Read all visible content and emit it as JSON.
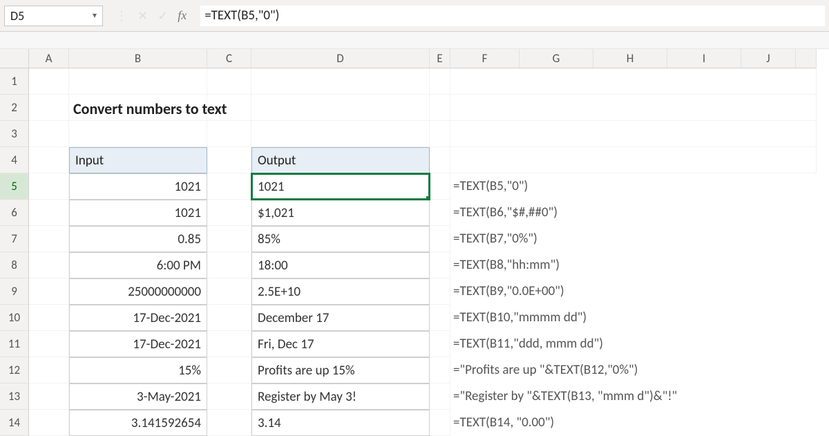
{
  "namebox": "D5",
  "formula_bar": "=TEXT(B5,\"0\")",
  "col_labels": [
    "A",
    "B",
    "C",
    "D",
    "E",
    "F",
    "G",
    "H",
    "I",
    "J"
  ],
  "col_widths_rest": [
    30,
    100,
    107,
    107,
    107,
    79
  ],
  "row_labels": [
    "1",
    "2",
    "3",
    "4",
    "5",
    "6",
    "7",
    "8",
    "9",
    "10",
    "11",
    "12",
    "13",
    "14"
  ],
  "title": "Convert numbers to text",
  "input_header": "Input",
  "output_header": "Output",
  "rows": [
    {
      "input": "1021",
      "output": "1021",
      "formula": "=TEXT(B5,\"0\")"
    },
    {
      "input": "1021",
      "output": "$1,021",
      "formula": "=TEXT(B6,\"$#,##0\")"
    },
    {
      "input": "0.85",
      "output": "85%",
      "formula": "=TEXT(B7,\"0%\")"
    },
    {
      "input": "6:00 PM",
      "output": "18:00",
      "formula": "=TEXT(B8,\"hh:mm\")"
    },
    {
      "input": "25000000000",
      "output": "2.5E+10",
      "formula": "=TEXT(B9,\"0.0E+00\")"
    },
    {
      "input": "17-Dec-2021",
      "output": "December 17",
      "formula": "=TEXT(B10,\"mmmm dd\")"
    },
    {
      "input": "17-Dec-2021",
      "output": "Fri, Dec 17",
      "formula": "=TEXT(B11,\"ddd, mmm dd\")"
    },
    {
      "input": "15%",
      "output": "Profits are up 15%",
      "formula": "=\"Profits are up \"&TEXT(B12,\"0%\")"
    },
    {
      "input": "3-May-2021",
      "output": "Register by May 3!",
      "formula": "=\"Register by \"&TEXT(B13, \"mmm d\")&\"!\""
    },
    {
      "input": "3.141592654",
      "output": "3.14",
      "formula": "=TEXT(B14, \"0.00\")"
    }
  ]
}
